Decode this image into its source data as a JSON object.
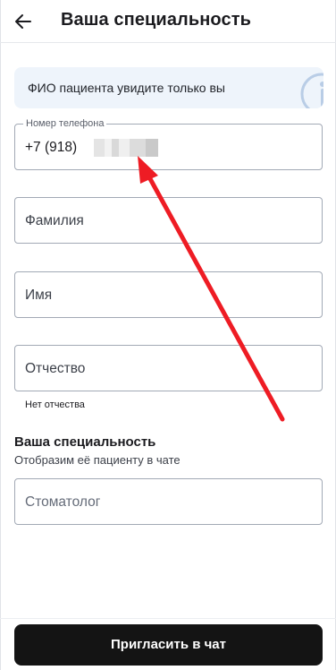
{
  "header": {
    "title": "Ваша специальность",
    "back_icon": "arrow-left-icon"
  },
  "info_banner": {
    "text": "ФИО пациента увидите только вы",
    "icon": "info-icon"
  },
  "form": {
    "phone": {
      "label": "Номер телефона",
      "value": "+7 (918)"
    },
    "last_name": {
      "placeholder": "Фамилия"
    },
    "first_name": {
      "placeholder": "Имя"
    },
    "patronymic": {
      "placeholder": "Отчество",
      "helper": "Нет отчества"
    }
  },
  "specialty": {
    "title": "Ваша специальность",
    "subtitle": "Отобразим её пациенту в чате",
    "value": "Стоматолог"
  },
  "footer": {
    "invite_label": "Пригласить в чат"
  },
  "annotation": {
    "arrow_color": "#ee1c24"
  }
}
